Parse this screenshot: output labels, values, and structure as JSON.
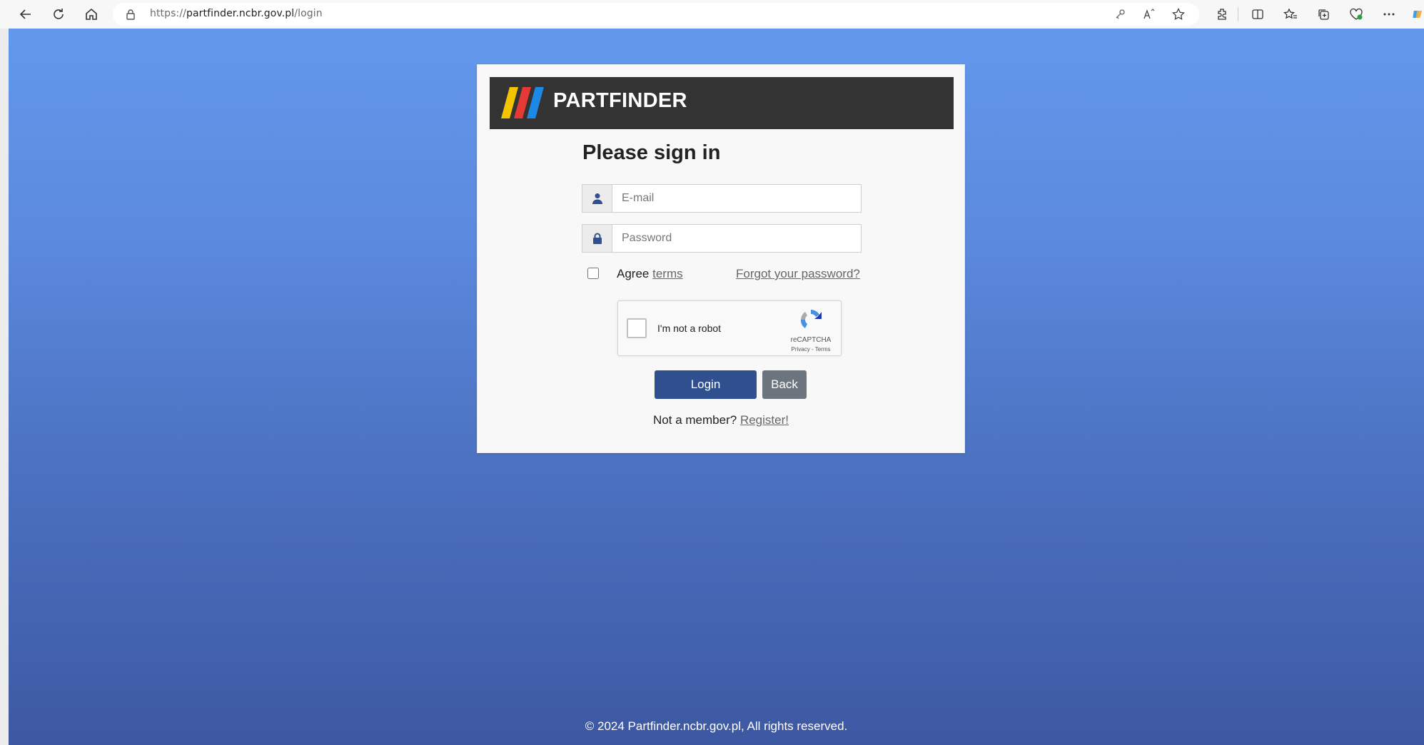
{
  "browser": {
    "url_prefix": "https://",
    "url_host": "partfinder.ncbr.gov.pl",
    "url_path": "/login"
  },
  "brand": {
    "name": "PARTFINDER",
    "logo_colors": [
      "#f5c400",
      "#e53935",
      "#1e88e5"
    ]
  },
  "login": {
    "title": "Please sign in",
    "email_placeholder": "E-mail",
    "password_placeholder": "Password",
    "agree_label": "Agree",
    "terms_link": "terms",
    "forgot_link": "Forgot your password?",
    "login_button": "Login",
    "back_button": "Back",
    "member_prefix": "Not a member?",
    "register_link": "Register!"
  },
  "recaptcha": {
    "label": "I'm not a robot",
    "brand": "reCAPTCHA",
    "links": "Privacy - Terms"
  },
  "footer": {
    "text": "© 2024 Partfinder.ncbr.gov.pl, All rights reserved."
  },
  "colors": {
    "primary_button": "#2f4f8f",
    "secondary_button": "#6c757d",
    "brand_bar": "#333333",
    "background_top": "#6298ec",
    "background_bottom": "#3d58a2"
  },
  "icons": {
    "email_addon": "user-icon",
    "password_addon": "lock-icon"
  }
}
